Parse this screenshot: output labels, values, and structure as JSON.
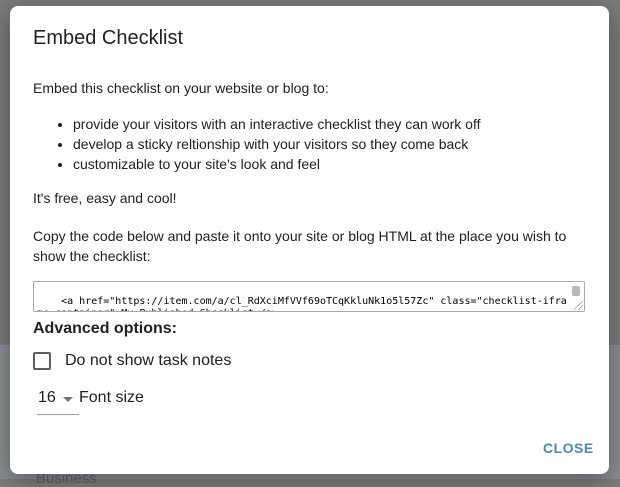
{
  "background": {
    "partial_text": "Business"
  },
  "dialog": {
    "title": "Embed Checklist",
    "intro": "Embed this checklist on your website or blog to:",
    "bullets": [
      "provide your visitors with an interactive checklist they can work off",
      "develop a sticky reltionship with your visitors so they come back",
      "customizable to your site's look and feel"
    ],
    "free_line": "It's free, easy and cool!",
    "copy_instruction": "Copy the code below and paste it onto your site or blog HTML at the place you wish to show the checklist:",
    "embed_code": "<a href=\"https://item.com/a/cl_RdXciMfVVf69oTCqKkluNk1o5l57Zc\" class=\"checklist-iframe-container\">My Published Checklist</a>",
    "advanced_title": "Advanced options:",
    "hide_notes_label": "Do not show task notes",
    "hide_notes_checked": false,
    "font_size_value": "16",
    "font_size_label": "Font size",
    "close_label": "CLOSE"
  },
  "colors": {
    "accent": "#4a89b8",
    "text": "#212121",
    "overlay": "#7d7d7d"
  }
}
